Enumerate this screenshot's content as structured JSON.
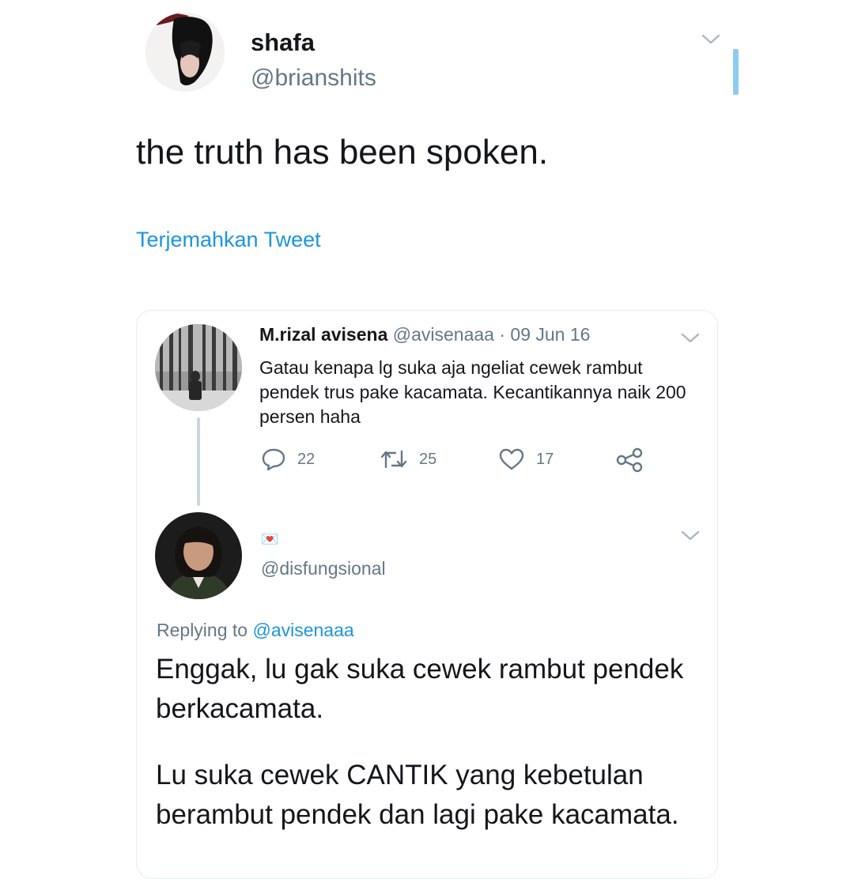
{
  "main_tweet": {
    "display_name": "shafa",
    "handle": "@brianshits",
    "text": "the truth has been spoken.",
    "translate_link": "Terjemahkan Tweet"
  },
  "quoted": {
    "tweet": {
      "display_name": "M.rizal avisena",
      "handle": "@avisenaaa",
      "separator": "·",
      "date": "09 Jun 16",
      "text": "Gatau kenapa lg suka aja ngeliat cewek rambut pendek trus pake kacamata. Kecantikannya naik 200 persen haha",
      "actions": {
        "replies": "22",
        "retweets": "25",
        "likes": "17"
      }
    },
    "reply": {
      "display_name_emoji": "💌",
      "handle": "@disfungsional",
      "replying_prefix": "Replying to",
      "replying_to": "@avisenaaa",
      "paragraph1": "Enggak, lu gak suka cewek rambut pendek berkacamata.",
      "paragraph2": "Lu suka cewek CANTIK yang kebetulan berambut pendek dan lagi pake kacamata."
    }
  },
  "colors": {
    "link": "#1b95e0",
    "muted": "#657786",
    "text": "#14171a",
    "accent_bar": "#8ecbf2"
  },
  "icons": [
    "chevron-down-icon",
    "reply-icon",
    "retweet-icon",
    "like-icon",
    "share-icon"
  ]
}
